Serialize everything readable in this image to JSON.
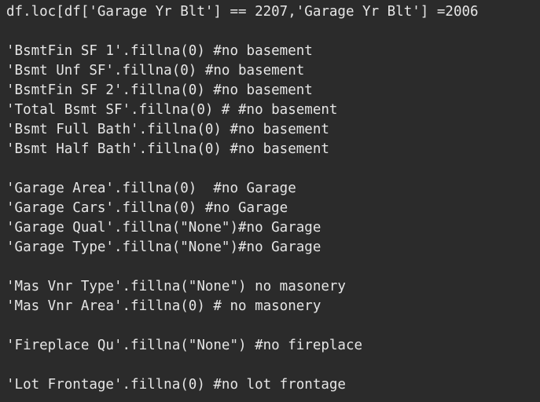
{
  "code": {
    "lines": [
      "df.loc[df['Garage Yr Blt'] == 2207,'Garage Yr Blt'] =2006",
      "",
      "'BsmtFin SF 1'.fillna(0) #no basement",
      "'Bsmt Unf SF'.fillna(0) #no basement",
      "'BsmtFin SF 2'.fillna(0) #no basement",
      "'Total Bsmt SF'.fillna(0) # #no basement",
      "'Bsmt Full Bath'.fillna(0) #no basement",
      "'Bsmt Half Bath'.fillna(0) #no basement",
      "",
      "'Garage Area'.fillna(0)  #no Garage",
      "'Garage Cars'.fillna(0) #no Garage",
      "'Garage Qual'.fillna(\"None\")#no Garage",
      "'Garage Type'.fillna(\"None\")#no Garage",
      "",
      "'Mas Vnr Type'.fillna(\"None\") no masonery",
      "'Mas Vnr Area'.fillna(0) # no masonery",
      "",
      "'Fireplace Qu'.fillna(\"None\") #no fireplace",
      "",
      "'Lot Frontage'.fillna(0) #no lot frontage"
    ]
  }
}
